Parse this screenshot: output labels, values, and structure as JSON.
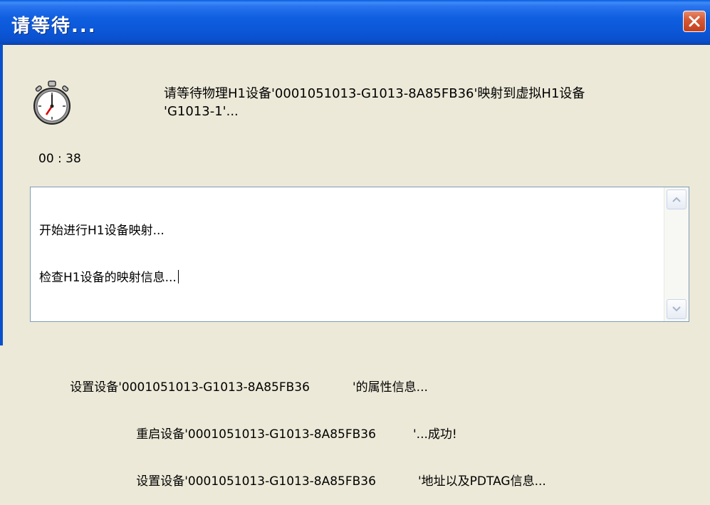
{
  "window": {
    "title": "请等待..."
  },
  "message": {
    "line1": "请等待物理H1设备'0001051013-G1013-8A85FB36'映射到虚拟H1设备",
    "line2": "'G1013-1'..."
  },
  "timer": {
    "value": "00 : 38"
  },
  "log": {
    "line1": "开始进行H1设备映射...",
    "line2": "检查H1设备的映射信息...",
    "line3_left": "设置设备'0001051013-G1013-8A85FB36",
    "line3_right": "'的属性信息...",
    "line4_left": "重启设备'0001051013-G1013-8A85FB36",
    "line4_right": "'...成功!",
    "line5_left": "设置设备'0001051013-G1013-8A85FB36",
    "line5_right": "'地址以及PDTAG信息..."
  },
  "icons": {
    "close": "close-icon",
    "stopwatch": "stopwatch-icon",
    "scroll_up": "scroll-up-arrow-icon",
    "scroll_down": "scroll-down-arrow-icon"
  },
  "colors": {
    "titlebar": "#0a57d8",
    "close_button": "#d65a35",
    "dialog_background": "#ece9d8"
  }
}
